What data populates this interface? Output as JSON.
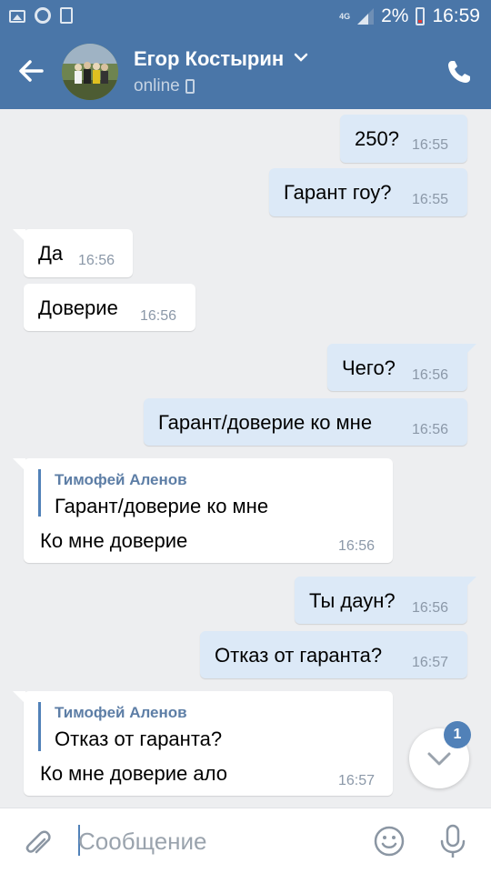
{
  "status_bar": {
    "network": "4G",
    "battery": "2%",
    "time": "16:59"
  },
  "header": {
    "title": "Егор Костырин",
    "subtitle": "online"
  },
  "messages": [
    {
      "text": "250?",
      "time": "16:55",
      "direction": "out"
    },
    {
      "text": "Гарант гоу?",
      "time": "16:55",
      "direction": "out"
    },
    {
      "text": "Да",
      "time": "16:56",
      "direction": "in"
    },
    {
      "text": "Доверие",
      "time": "16:56",
      "direction": "in"
    },
    {
      "text": "Чего?",
      "time": "16:56",
      "direction": "out"
    },
    {
      "text": "Гарант/доверие ко мне",
      "time": "16:56",
      "direction": "out"
    },
    {
      "text": "Ко мне доверие",
      "time": "16:56",
      "direction": "in",
      "quote": {
        "author": "Тимофей Аленов",
        "text": "Гарант/доверие ко мне"
      }
    },
    {
      "text": "Ты даун?",
      "time": "16:56",
      "direction": "out"
    },
    {
      "text": "Отказ от гаранта?",
      "time": "16:57",
      "direction": "out"
    },
    {
      "text": "Ко мне доверие ало",
      "time": "16:57",
      "direction": "in",
      "quote": {
        "author": "Тимофей Аленов",
        "text": "Отказ от гаранта?"
      }
    }
  ],
  "scroll_badge": "1",
  "input": {
    "placeholder": "Сообщение"
  },
  "colors": {
    "header": "#4a76a8",
    "outgoing_bubble": "#dce9f7",
    "incoming_bubble": "#ffffff",
    "background": "#edeef0",
    "accent": "#5181b8"
  }
}
